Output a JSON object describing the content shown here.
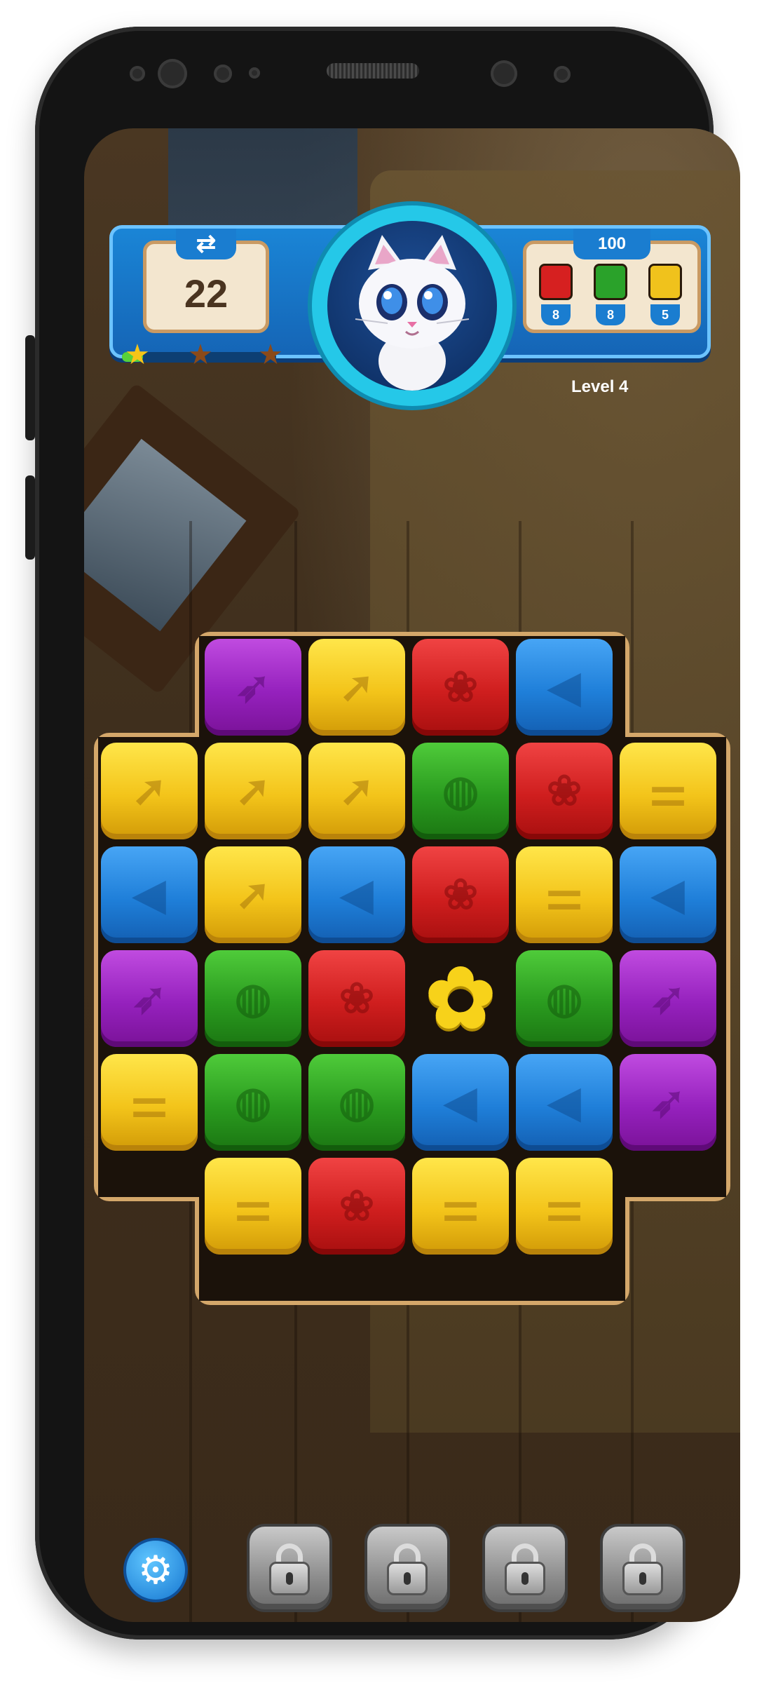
{
  "hud": {
    "moves_left": "22",
    "stars": [
      {
        "name": "star-1",
        "earned": true,
        "color": "#f5c518"
      },
      {
        "name": "star-2",
        "earned": false,
        "color": "#8a4a1a"
      },
      {
        "name": "star-3",
        "earned": false,
        "color": "#8a4a1a"
      }
    ],
    "score_target": "100",
    "goals": [
      {
        "color": "red",
        "hex": "#d62020",
        "count": "8"
      },
      {
        "color": "green",
        "hex": "#2aa22a",
        "count": "8"
      },
      {
        "color": "yellow",
        "hex": "#f0c21c",
        "count": "5"
      }
    ],
    "level": "Level 4"
  },
  "board": {
    "tile_colors": {
      "yellow": "#f3c41a",
      "blue": "#1f7fd9",
      "red": "#cf1e1e",
      "green": "#2a9b1f",
      "purple": "#9521bd"
    },
    "grid": [
      [
        null,
        {
          "color": "purple",
          "icon": "bird"
        },
        {
          "color": "yellow",
          "icon": "rocket"
        },
        {
          "color": "red",
          "icon": "paw"
        },
        {
          "color": "blue",
          "icon": "fish"
        },
        null
      ],
      [
        {
          "color": "yellow",
          "icon": "rocket"
        },
        {
          "color": "yellow",
          "icon": "rocket"
        },
        {
          "color": "yellow",
          "icon": "rocket"
        },
        {
          "color": "green",
          "icon": "ball"
        },
        {
          "color": "red",
          "icon": "paw"
        },
        {
          "color": "yellow",
          "icon": "bone"
        }
      ],
      [
        {
          "color": "blue",
          "icon": "fish"
        },
        {
          "color": "yellow",
          "icon": "rocket"
        },
        {
          "color": "blue",
          "icon": "fish"
        },
        {
          "color": "red",
          "icon": "paw"
        },
        {
          "color": "yellow",
          "icon": "bone"
        },
        {
          "color": "blue",
          "icon": "fish"
        }
      ],
      [
        {
          "color": "purple",
          "icon": "bird"
        },
        {
          "color": "green",
          "icon": "ball"
        },
        {
          "color": "red",
          "icon": "paw"
        },
        {
          "color": "flower",
          "icon": "flower"
        },
        {
          "color": "green",
          "icon": "ball"
        },
        {
          "color": "purple",
          "icon": "bird"
        }
      ],
      [
        {
          "color": "yellow",
          "icon": "bone"
        },
        {
          "color": "green",
          "icon": "ball"
        },
        {
          "color": "green",
          "icon": "ball"
        },
        {
          "color": "blue",
          "icon": "fish"
        },
        {
          "color": "blue",
          "icon": "fish"
        },
        {
          "color": "purple",
          "icon": "bird"
        }
      ],
      [
        null,
        {
          "color": "yellow",
          "icon": "bone"
        },
        {
          "color": "red",
          "icon": "paw"
        },
        {
          "color": "yellow",
          "icon": "bone"
        },
        {
          "color": "yellow",
          "icon": "bone"
        },
        null
      ]
    ]
  },
  "bottom_bar": {
    "settings_icon": "gear-icon",
    "boosters": [
      {
        "state": "locked",
        "icon": "lock-icon"
      },
      {
        "state": "locked",
        "icon": "lock-icon"
      },
      {
        "state": "locked",
        "icon": "lock-icon"
      },
      {
        "state": "locked",
        "icon": "lock-icon"
      }
    ]
  }
}
